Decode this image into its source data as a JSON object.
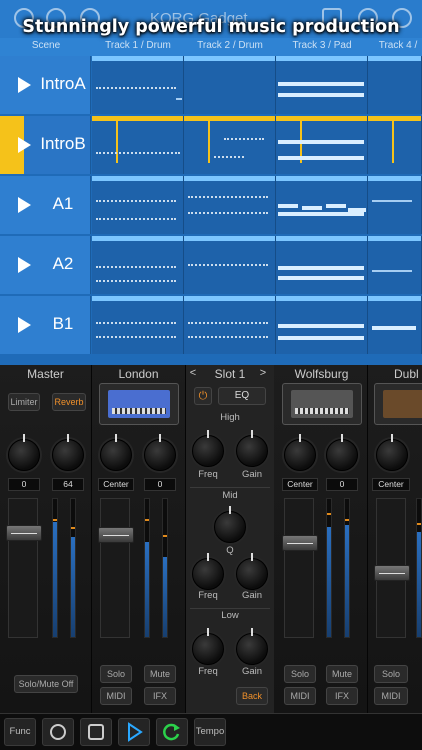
{
  "headline": "Stunningly powerful music production",
  "app_title": "KORG Gadget",
  "column_headers": [
    "Scene",
    "Track 1 / Drum",
    "Track 2 / Drum",
    "Track 3 / Pad",
    "Track 4 /"
  ],
  "scenes": [
    {
      "label": "IntroA",
      "active": false
    },
    {
      "label": "IntroB",
      "active": true
    },
    {
      "label": "A1",
      "active": false
    },
    {
      "label": "A2",
      "active": false
    },
    {
      "label": "B1",
      "active": false
    }
  ],
  "colors": {
    "accent": "#f5c21a",
    "seq_bg": "#1f6bb8",
    "meter": "#2a6fc0",
    "orange": "#f0902a",
    "play": "#2aa8ff",
    "loop": "#2bd04a"
  },
  "master": {
    "title": "Master",
    "limiter": "Limiter",
    "reverb": "Reverb",
    "values": [
      "0",
      "64"
    ],
    "solo_mute_off": "Solo/Mute Off"
  },
  "london": {
    "title": "London",
    "values": [
      "Center",
      "0"
    ],
    "solo": "Solo",
    "mute": "Mute",
    "midi": "MIDI",
    "ifx": "IFX"
  },
  "slot": {
    "prev": "<",
    "title": "Slot 1",
    "next": ">",
    "eq": "EQ",
    "high": "High",
    "mid": "Mid",
    "low": "Low",
    "freq": "Freq",
    "gain": "Gain",
    "q": "Q",
    "back": "Back"
  },
  "wolfsburg": {
    "title": "Wolfsburg",
    "values": [
      "Center",
      "0"
    ],
    "solo": "Solo",
    "mute": "Mute",
    "midi": "MIDI",
    "ifx": "IFX"
  },
  "dublin": {
    "title": "Dubl",
    "values": [
      "Center"
    ],
    "solo": "Solo",
    "midi": "MIDI"
  },
  "transport": {
    "func": "Func",
    "tempo": "Tempo"
  }
}
